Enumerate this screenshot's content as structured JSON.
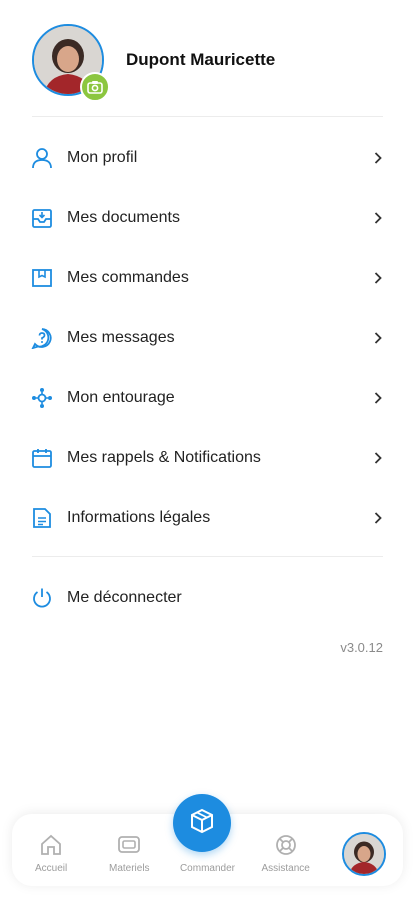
{
  "user": {
    "name": "Dupont Mauricette"
  },
  "menu": {
    "items": [
      {
        "label": "Mon profil",
        "icon": "user-icon"
      },
      {
        "label": "Mes documents",
        "icon": "inbox-tray-icon"
      },
      {
        "label": "Mes commandes",
        "icon": "box-icon"
      },
      {
        "label": "Mes messages",
        "icon": "question-bubble-icon"
      },
      {
        "label": "Mon entourage",
        "icon": "network-icon"
      },
      {
        "label": "Mes rappels & Notifications",
        "icon": "calendar-icon"
      },
      {
        "label": "Informations légales",
        "icon": "document-icon"
      }
    ],
    "logout_label": "Me déconnecter"
  },
  "version": "v3.0.12",
  "tabbar": {
    "tabs": [
      {
        "label": "Accueil",
        "icon": "home-icon"
      },
      {
        "label": "Materiels",
        "icon": "device-icon"
      },
      {
        "label": "Commander",
        "icon": "package-icon"
      },
      {
        "label": "Assistance",
        "icon": "lifebuoy-icon"
      }
    ]
  },
  "colors": {
    "accent": "#1d8ce0",
    "badge": "#8cc63f",
    "muted": "#9c9c9c"
  }
}
